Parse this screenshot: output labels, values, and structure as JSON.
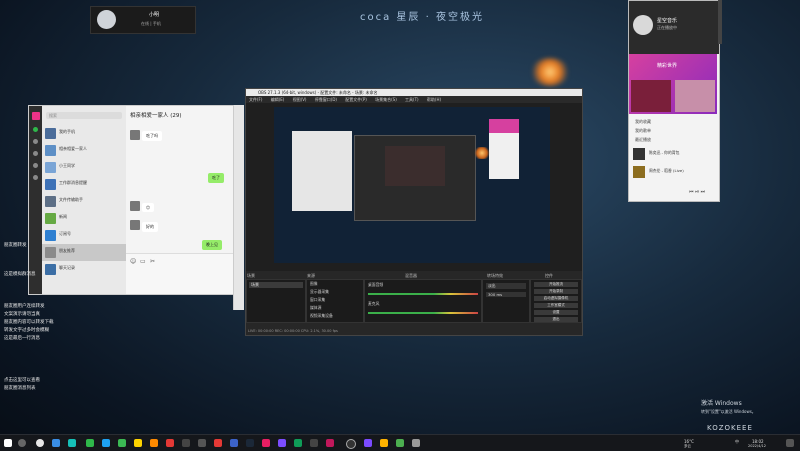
{
  "desktop": {
    "center_title": "coca 星辰 · 夜空极光",
    "left_text": [
      "朋友圈转发",
      "这是模拟群消息",
      "朋友圈用户连续转发",
      "文案演示请勿当真",
      "朋友圈内容可以转发下载",
      "转发文字过多时会模糊",
      "这是最后一行消息"
    ],
    "left_block": [
      "点击这里可以查看",
      "朋友圈消息列表",
      "全部用户头像如下"
    ]
  },
  "notification": {
    "name": "小明",
    "sub": "在线 | 手机"
  },
  "chat": {
    "search_placeholder": "搜索",
    "title": "相亲相爱一家人 (29)",
    "items": [
      {
        "label": "我的手机"
      },
      {
        "label": "相亲相爱一家人"
      },
      {
        "label": "小王同学"
      },
      {
        "label": "工作群消息提醒"
      },
      {
        "label": "文件传输助手"
      },
      {
        "label": "新闻"
      },
      {
        "label": "订阅号"
      },
      {
        "label": "朋友推荐"
      },
      {
        "label": "聊天记录"
      }
    ],
    "bubbles": [
      {
        "side": "l",
        "text": "吃了吗"
      },
      {
        "side": "r",
        "text": "吃了"
      },
      {
        "side": "l",
        "text": "😊"
      },
      {
        "side": "l",
        "text": "好的"
      },
      {
        "side": "r",
        "text": "晚上见"
      }
    ]
  },
  "obs": {
    "title": "OBS 27.1.3 (64-bit, windows) - 配置文件: 未命名 - 场景: 未命名",
    "menu": [
      "文件(F)",
      "编辑(E)",
      "视图(V)",
      "停靠窗口(D)",
      "配置文件(P)",
      "场景集合(S)",
      "工具(T)",
      "帮助(H)"
    ],
    "panels": {
      "scenes": "场景",
      "sources": "来源",
      "mixer": "混音器",
      "transitions": "转场特效",
      "controls": "控件"
    },
    "scene_item": "场景",
    "sources": [
      "图像",
      "显示器采集",
      "窗口采集",
      "媒体源",
      "视频采集设备"
    ],
    "mixer": [
      {
        "label": "桌面音频",
        "db": "0.0 dB"
      },
      {
        "label": "麦克风",
        "db": "0.0 dB"
      }
    ],
    "transition": {
      "type": "淡出",
      "duration": "300 ms"
    },
    "controls": [
      "开始推流",
      "开始录制",
      "启动虚拟摄像机",
      "工作室模式",
      "设置",
      "退出"
    ],
    "status": "LIVE: 00:00:00  REC: 00:00:00  CPU: 2.1%, 30.00 fps",
    "label_live": "未处理"
  },
  "music": {
    "name": "星空音乐",
    "sub": "正在播放中",
    "banner_title": "精彩世界",
    "menu": [
      "我的收藏",
      "我的歌单",
      "最近播放"
    ],
    "tracks": [
      {
        "title": "陈奕迅 - 你的背包"
      },
      {
        "title": "周杰伦 - 稻香 (Live)"
      }
    ]
  },
  "watermark": {
    "line1": "激活 Windows",
    "line2": "转到\"设置\"以激活 Windows。",
    "logo": "KOZOKEEE"
  },
  "taskbar": {
    "temp": "16°C",
    "weather": "多云",
    "time": "18:02",
    "date": "2022/4/12",
    "lang": "中"
  },
  "colors": {
    "accent": "#d6409f",
    "bg": "#172a3d",
    "chat_green": "#95ec69"
  }
}
